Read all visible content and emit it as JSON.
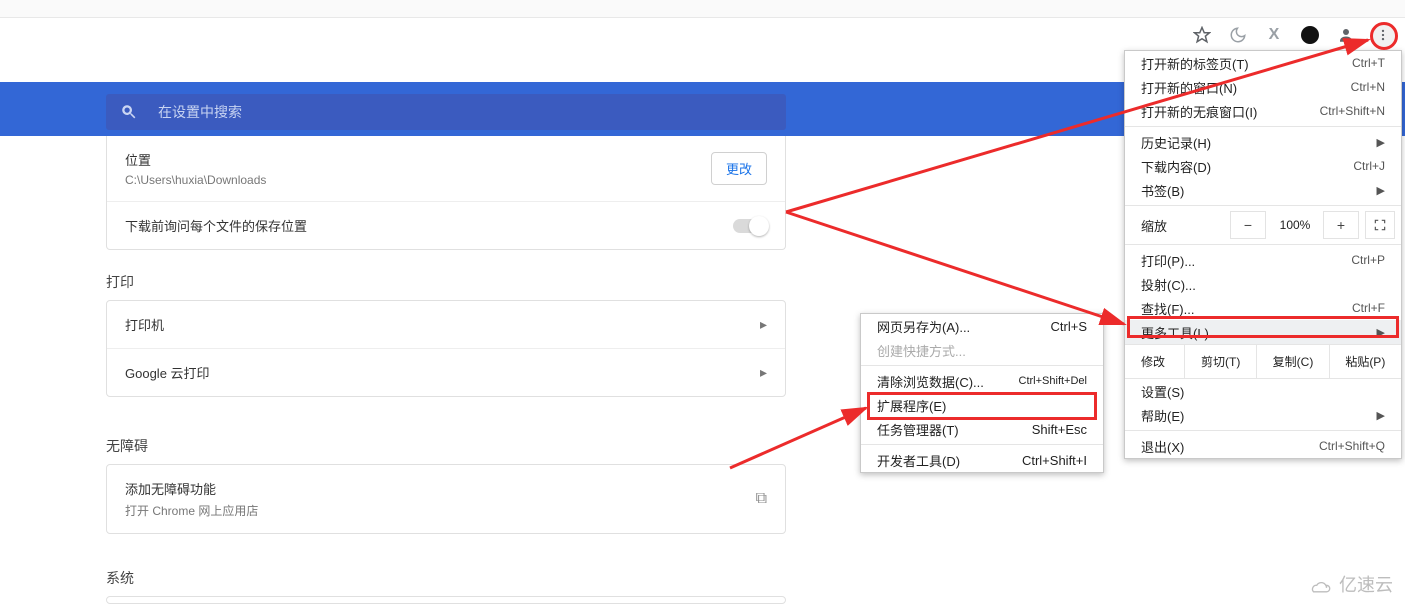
{
  "toolbar": {
    "star_icon": "star-icon",
    "moon_icon": "moon-icon",
    "x_icon": "x-letter-icon",
    "circle_icon": "circle-icon",
    "profile_icon": "profile-icon",
    "kebab_icon": "kebab-menu-icon"
  },
  "search": {
    "placeholder": "在设置中搜索"
  },
  "downloads": {
    "location_label": "位置",
    "location_path": "C:\\Users\\huxia\\Downloads",
    "change_button": "更改",
    "ask_label": "下载前询问每个文件的保存位置"
  },
  "print": {
    "section": "打印",
    "printer": "打印机",
    "cloud": "Google 云打印"
  },
  "a11y": {
    "section": "无障碍",
    "add": "添加无障碍功能",
    "sub": "打开 Chrome 网上应用店"
  },
  "system": {
    "section": "系统"
  },
  "menu": {
    "new_tab": {
      "label": "打开新的标签页(T)",
      "sc": "Ctrl+T"
    },
    "new_window": {
      "label": "打开新的窗口(N)",
      "sc": "Ctrl+N"
    },
    "incognito": {
      "label": "打开新的无痕窗口(I)",
      "sc": "Ctrl+Shift+N"
    },
    "history": {
      "label": "历史记录(H)"
    },
    "downloads": {
      "label": "下载内容(D)",
      "sc": "Ctrl+J"
    },
    "bookmarks": {
      "label": "书签(B)"
    },
    "zoom": {
      "label": "缩放",
      "value": "100%",
      "minus": "−",
      "plus": "+"
    },
    "print": {
      "label": "打印(P)...",
      "sc": "Ctrl+P"
    },
    "cast": {
      "label": "投射(C)..."
    },
    "find": {
      "label": "查找(F)...",
      "sc": "Ctrl+F"
    },
    "more_tools": {
      "label": "更多工具(L)"
    },
    "edit": {
      "label": "修改",
      "cut": "剪切(T)",
      "copy": "复制(C)",
      "paste": "粘贴(P)"
    },
    "settings": {
      "label": "设置(S)"
    },
    "help": {
      "label": "帮助(E)"
    },
    "exit": {
      "label": "退出(X)",
      "sc": "Ctrl+Shift+Q"
    }
  },
  "submenu": {
    "save_as": {
      "label": "网页另存为(A)...",
      "sc": "Ctrl+S"
    },
    "create_shortcut": {
      "label": "创建快捷方式..."
    },
    "clear_data": {
      "label": "清除浏览数据(C)...",
      "sc": "Ctrl+Shift+Del"
    },
    "extensions": {
      "label": "扩展程序(E)"
    },
    "task_manager": {
      "label": "任务管理器(T)",
      "sc": "Shift+Esc"
    },
    "dev_tools": {
      "label": "开发者工具(D)",
      "sc": "Ctrl+Shift+I"
    }
  },
  "watermark": "亿速云"
}
